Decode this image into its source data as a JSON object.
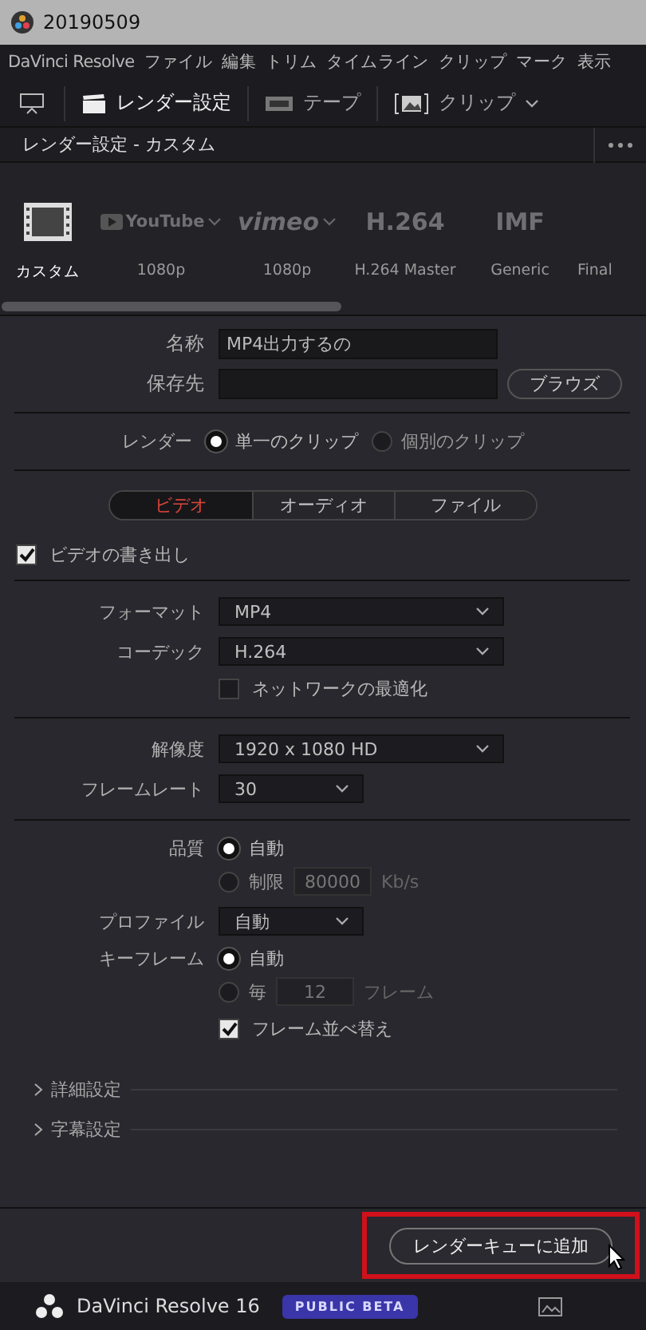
{
  "window": {
    "title": "20190509"
  },
  "menu": [
    "DaVinci Resolve",
    "ファイル",
    "編集",
    "トリム",
    "タイムライン",
    "クリップ",
    "マーク",
    "表示"
  ],
  "toolbar": [
    {
      "kind": "monitor"
    },
    {
      "kind": "clapper",
      "label": "レンダー設定",
      "selected": true
    },
    {
      "kind": "tape",
      "label": "テープ",
      "selected": false
    },
    {
      "kind": "clip",
      "label": "クリップ",
      "selected": false
    }
  ],
  "panel": {
    "title": "レンダー設定 - カスタム"
  },
  "presets": [
    {
      "kind": "custom",
      "label": "カスタム",
      "selected": true
    },
    {
      "kind": "youtube",
      "logo": "YouTube",
      "label": "1080p",
      "selected": false
    },
    {
      "kind": "vimeo",
      "logo": "vimeo",
      "label": "1080p",
      "selected": false
    },
    {
      "kind": "text",
      "logo": "H.264",
      "label": "H.264 Master",
      "selected": false
    },
    {
      "kind": "text",
      "logo": "IMF",
      "label": "Generic",
      "selected": false
    },
    {
      "kind": "partial",
      "label": "Final",
      "selected": false
    }
  ],
  "file": {
    "name_label": "名称",
    "name_value": "MP4出力するの",
    "location_label": "保存先",
    "browse_button": "ブラウズ"
  },
  "render": {
    "label": "レンダー",
    "options": [
      {
        "label": "単一のクリップ",
        "selected": true
      },
      {
        "label": "個別のクリップ",
        "selected": false
      }
    ]
  },
  "tabs": [
    {
      "label": "ビデオ",
      "selected": true
    },
    {
      "label": "オーディオ",
      "selected": false
    },
    {
      "label": "ファイル",
      "selected": false
    }
  ],
  "export_video": {
    "label": "ビデオの書き出し",
    "checked": true
  },
  "settings": [
    [
      {
        "kind": "select",
        "label": "フォーマット",
        "value": "MP4"
      },
      {
        "kind": "select",
        "label": "コーデック",
        "value": "H.264"
      },
      {
        "kind": "checkbox",
        "label": "ネットワークの最適化",
        "checked": false
      }
    ],
    [
      {
        "kind": "select",
        "label": "解像度",
        "value": "1920 x 1080 HD"
      },
      {
        "kind": "short_select",
        "label": "フレームレート",
        "value": "30"
      }
    ],
    [
      {
        "kind": "radio",
        "label": "品質",
        "options": [
          {
            "label": "自動",
            "selected": true
          },
          {
            "label": "制限",
            "selected": false,
            "value": "80000",
            "unit": "Kb/s"
          }
        ]
      },
      {
        "kind": "short_select",
        "label": "プロファイル",
        "value": "自動"
      },
      {
        "kind": "radio",
        "label": "キーフレーム",
        "options": [
          {
            "label": "自動",
            "selected": true
          },
          {
            "label": "毎",
            "selected": false,
            "value": "12",
            "unit": "フレーム"
          }
        ]
      },
      {
        "kind": "checkbox",
        "label": "フレーム並べ替え",
        "checked": true
      }
    ]
  ],
  "sections": [
    {
      "label": "詳細設定",
      "expanded": false
    },
    {
      "label": "字幕設定",
      "expanded": false
    }
  ],
  "add_button": {
    "label": "レンダーキューに追加",
    "highlighted": true
  },
  "footer": {
    "app": "DaVinci Resolve 16",
    "badge": "PUBLIC BETA"
  }
}
